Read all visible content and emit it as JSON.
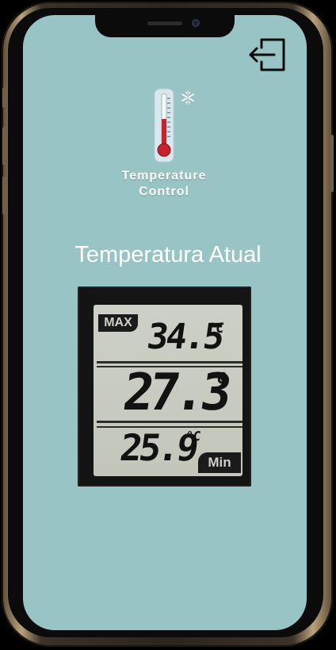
{
  "app": {
    "name_line1": "Temperature",
    "name_line2": "Control",
    "screen_title": "Temperatura Atual"
  },
  "thermometer": {
    "max_label": "MAX",
    "max_value": "34.5",
    "current_value": "27.3",
    "min_value": "25.9",
    "min_label": "Min",
    "unit": "°C"
  },
  "icons": {
    "logout": "logout-icon",
    "logo": "thermometer-icon",
    "snowflake": "snowflake-icon"
  },
  "colors": {
    "screen_background": "#99c4c5",
    "text": "#ffffff"
  }
}
